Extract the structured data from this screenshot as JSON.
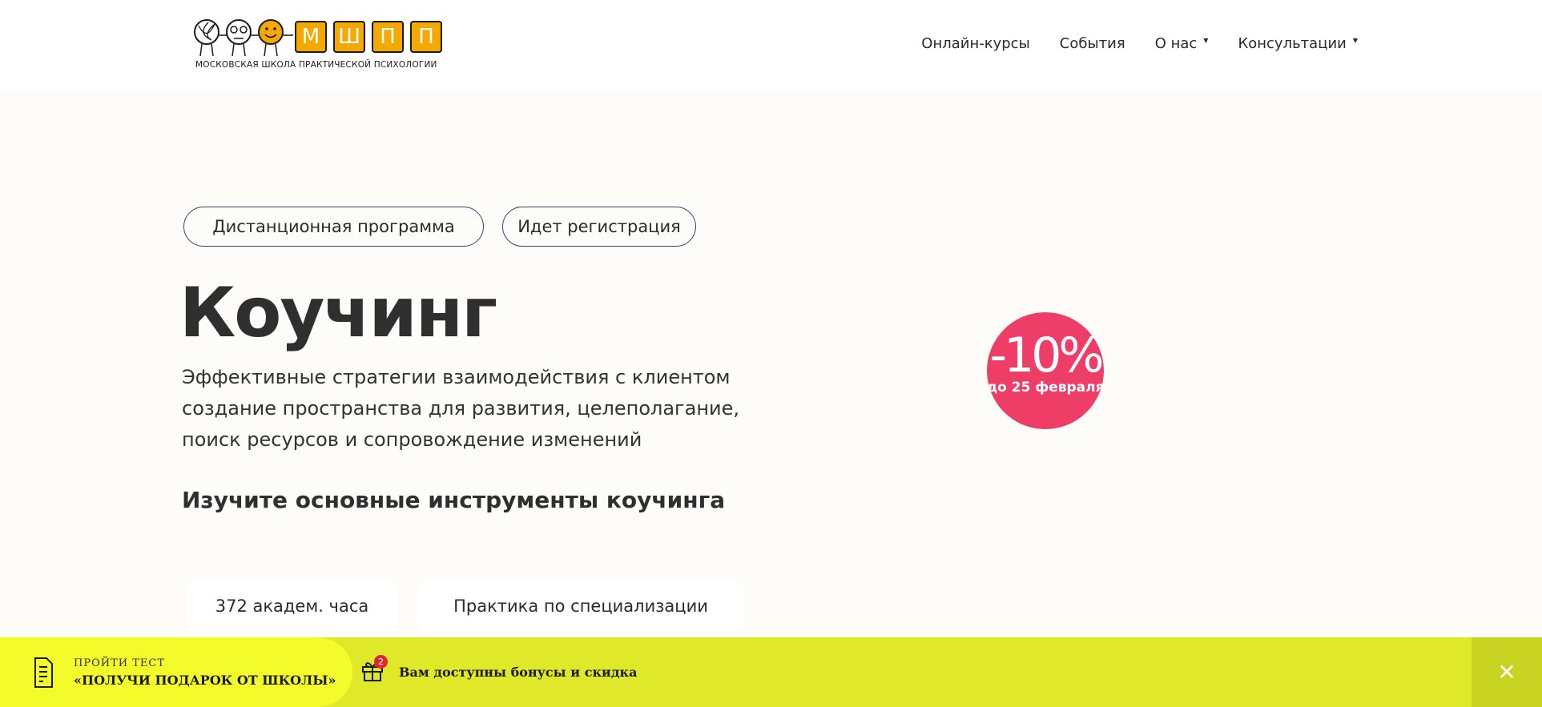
{
  "logo": {
    "letters": [
      "М",
      "Ш",
      "П",
      "П"
    ],
    "caption": "МОСКОВСКАЯ ШКОЛА ПРАКТИЧЕСКОЙ ПСИХОЛОГИИ",
    "brand_color": "#f4a800"
  },
  "nav": {
    "items": [
      {
        "label": "Онлайн-курсы",
        "has_dropdown": false
      },
      {
        "label": "События",
        "has_dropdown": false
      },
      {
        "label": "О нас",
        "has_dropdown": true
      },
      {
        "label": "Консультации",
        "has_dropdown": true
      }
    ],
    "caret_glyph": "▼"
  },
  "hero": {
    "chips": [
      "Дистанционная программа",
      "Идет регистрация"
    ],
    "title": "Коучинг",
    "subtitle": "Эффективные стратегии взаимодействия с клиентом создание пространства для развития, целеполагание, поиск ресурсов и сопровождение изменений",
    "subheading": "Изучите основные инструменты коучинга",
    "discount": {
      "value": "-10%",
      "deadline": "до 25 февраля",
      "color": "#ee3d66"
    },
    "features": [
      "372 академ. часа",
      "Практика по специализации"
    ]
  },
  "bottom_bar": {
    "test_label_top": "ПРОЙТИ ТЕСТ",
    "test_label_bottom": "«ПОЛУЧИ ПОДАРОК ОТ ШКОЛЫ»",
    "gift_badge_count": "2",
    "bonus_text": "Вам доступны бонусы и скидка",
    "close_glyph": "✕",
    "colors": {
      "bar": "#e0e82a",
      "left_panel": "#f3fb2a",
      "close": "#c9d321",
      "badge": "#e0262e"
    }
  }
}
